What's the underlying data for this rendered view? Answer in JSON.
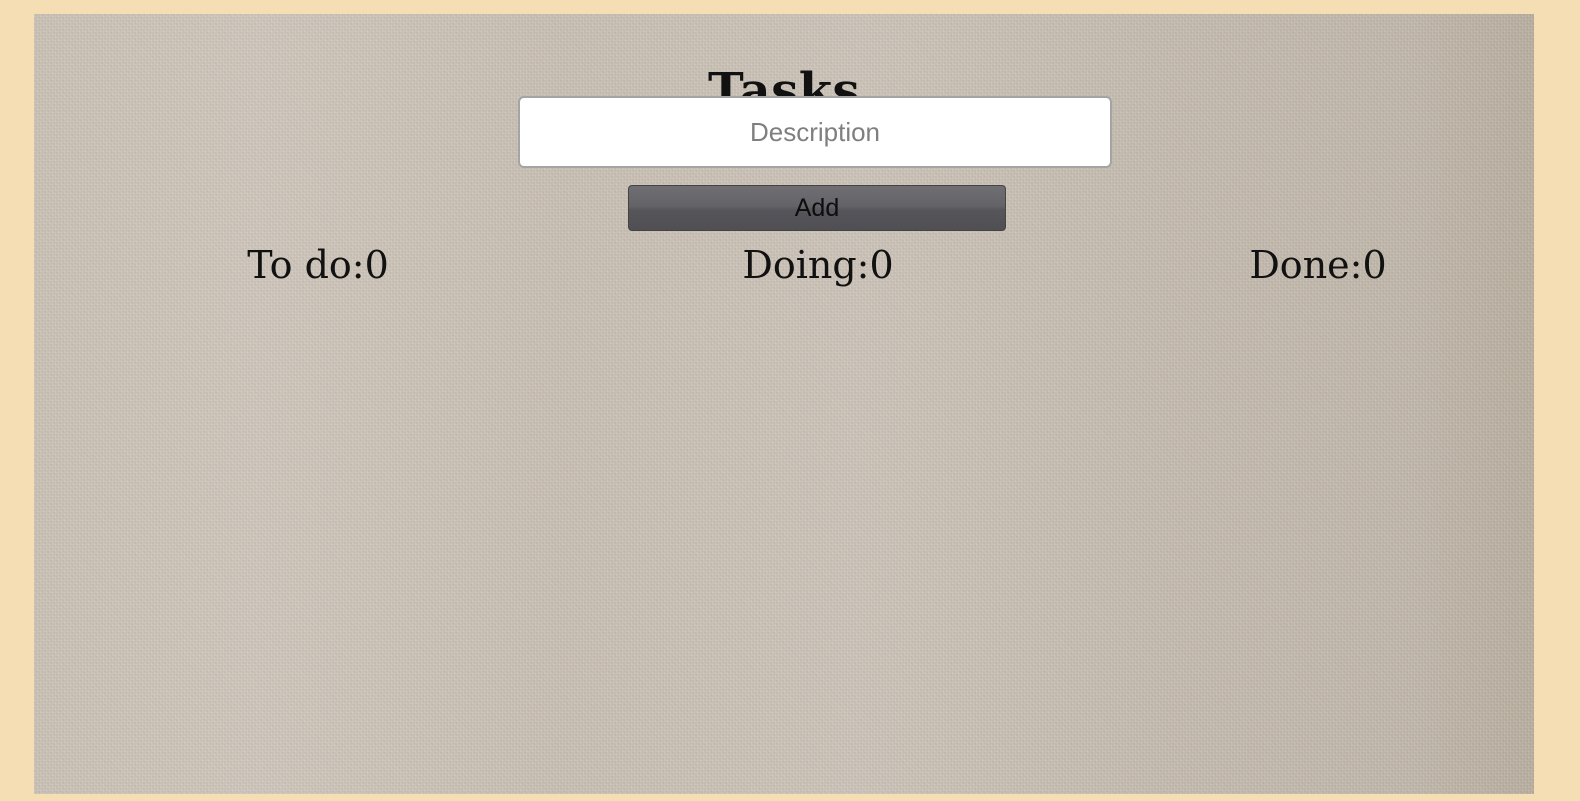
{
  "app": {
    "title": "Tasks"
  },
  "form": {
    "description_placeholder": "Description",
    "description_value": "",
    "add_label": "Add"
  },
  "columns": [
    {
      "label": "To do",
      "count": "0",
      "text": "To do:0"
    },
    {
      "label": "Doing",
      "count": "0",
      "text": "Doing:0"
    },
    {
      "label": "Done",
      "count": "0",
      "text": "Done:0"
    }
  ],
  "colors": {
    "page_background": "#f5deb3",
    "board_background": "#c8beb2",
    "button_background": "#5f5f64"
  }
}
